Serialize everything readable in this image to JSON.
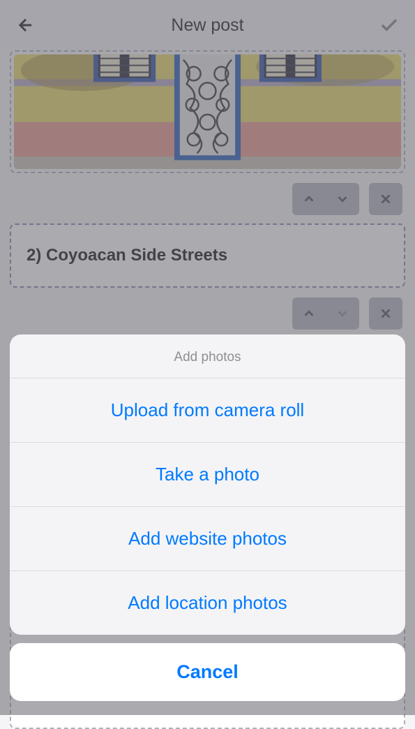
{
  "header": {
    "title": "New post"
  },
  "section": {
    "title": "2) Coyoacan Side Streets"
  },
  "sheet": {
    "title": "Add photos",
    "options": [
      "Upload from camera roll",
      "Take a photo",
      "Add website photos",
      "Add location photos"
    ],
    "cancel": "Cancel"
  }
}
